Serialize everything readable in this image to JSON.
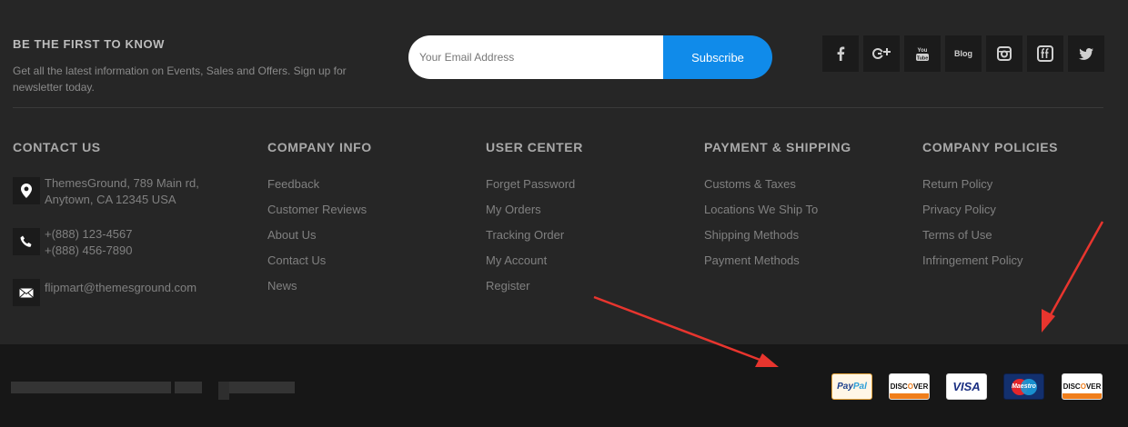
{
  "newsletter": {
    "title": "BE THE FIRST TO KNOW",
    "description": "Get all the latest information on Events, Sales and Offers. Sign up for newsletter today.",
    "email_placeholder": "Your Email Address",
    "subscribe_label": "Subscribe"
  },
  "social": [
    {
      "icon": "facebook-icon",
      "glyph": "f"
    },
    {
      "icon": "google-plus-icon",
      "glyph": "g+"
    },
    {
      "icon": "youtube-icon",
      "glyph": "You Tube"
    },
    {
      "icon": "blog-icon",
      "glyph": "Blog"
    },
    {
      "icon": "instagram-icon",
      "glyph": "ig"
    },
    {
      "icon": "flickr-icon",
      "glyph": "ff"
    },
    {
      "icon": "twitter-icon",
      "glyph": "tw"
    }
  ],
  "contact": {
    "title": "CONTACT US",
    "address_line1": "ThemesGround, 789 Main rd,",
    "address_line2": "Anytown, CA 12345 USA",
    "phone1": "+(888) 123-4567",
    "phone2": "+(888) 456-7890",
    "email": "flipmart@themesground.com"
  },
  "company_info": {
    "title": "COMPANY INFO",
    "links": [
      "Feedback",
      "Customer Reviews",
      "About Us",
      "Contact Us",
      "News"
    ]
  },
  "user_center": {
    "title": "USER CENTER",
    "links": [
      "Forget Password",
      "My Orders",
      "Tracking Order",
      "My Account",
      "Register"
    ]
  },
  "payment_shipping": {
    "title": "PAYMENT & SHIPPING",
    "links": [
      "Customs & Taxes",
      "Locations We Ship To",
      "Shipping Methods",
      "Payment Methods"
    ]
  },
  "company_policies": {
    "title": "COMPANY POLICIES",
    "links": [
      "Return Policy",
      "Privacy Policy",
      "Terms of Use",
      "Infringement Policy"
    ]
  },
  "payments": {
    "paypal_a": "Pay",
    "paypal_b": "Pal",
    "discover_a": "DISC",
    "discover_o": "O",
    "discover_b": "VER",
    "visa": "VISA",
    "maestro": "Maestro"
  },
  "colors": {
    "accent": "#108bea",
    "annotation_arrow": "#e8352e"
  }
}
